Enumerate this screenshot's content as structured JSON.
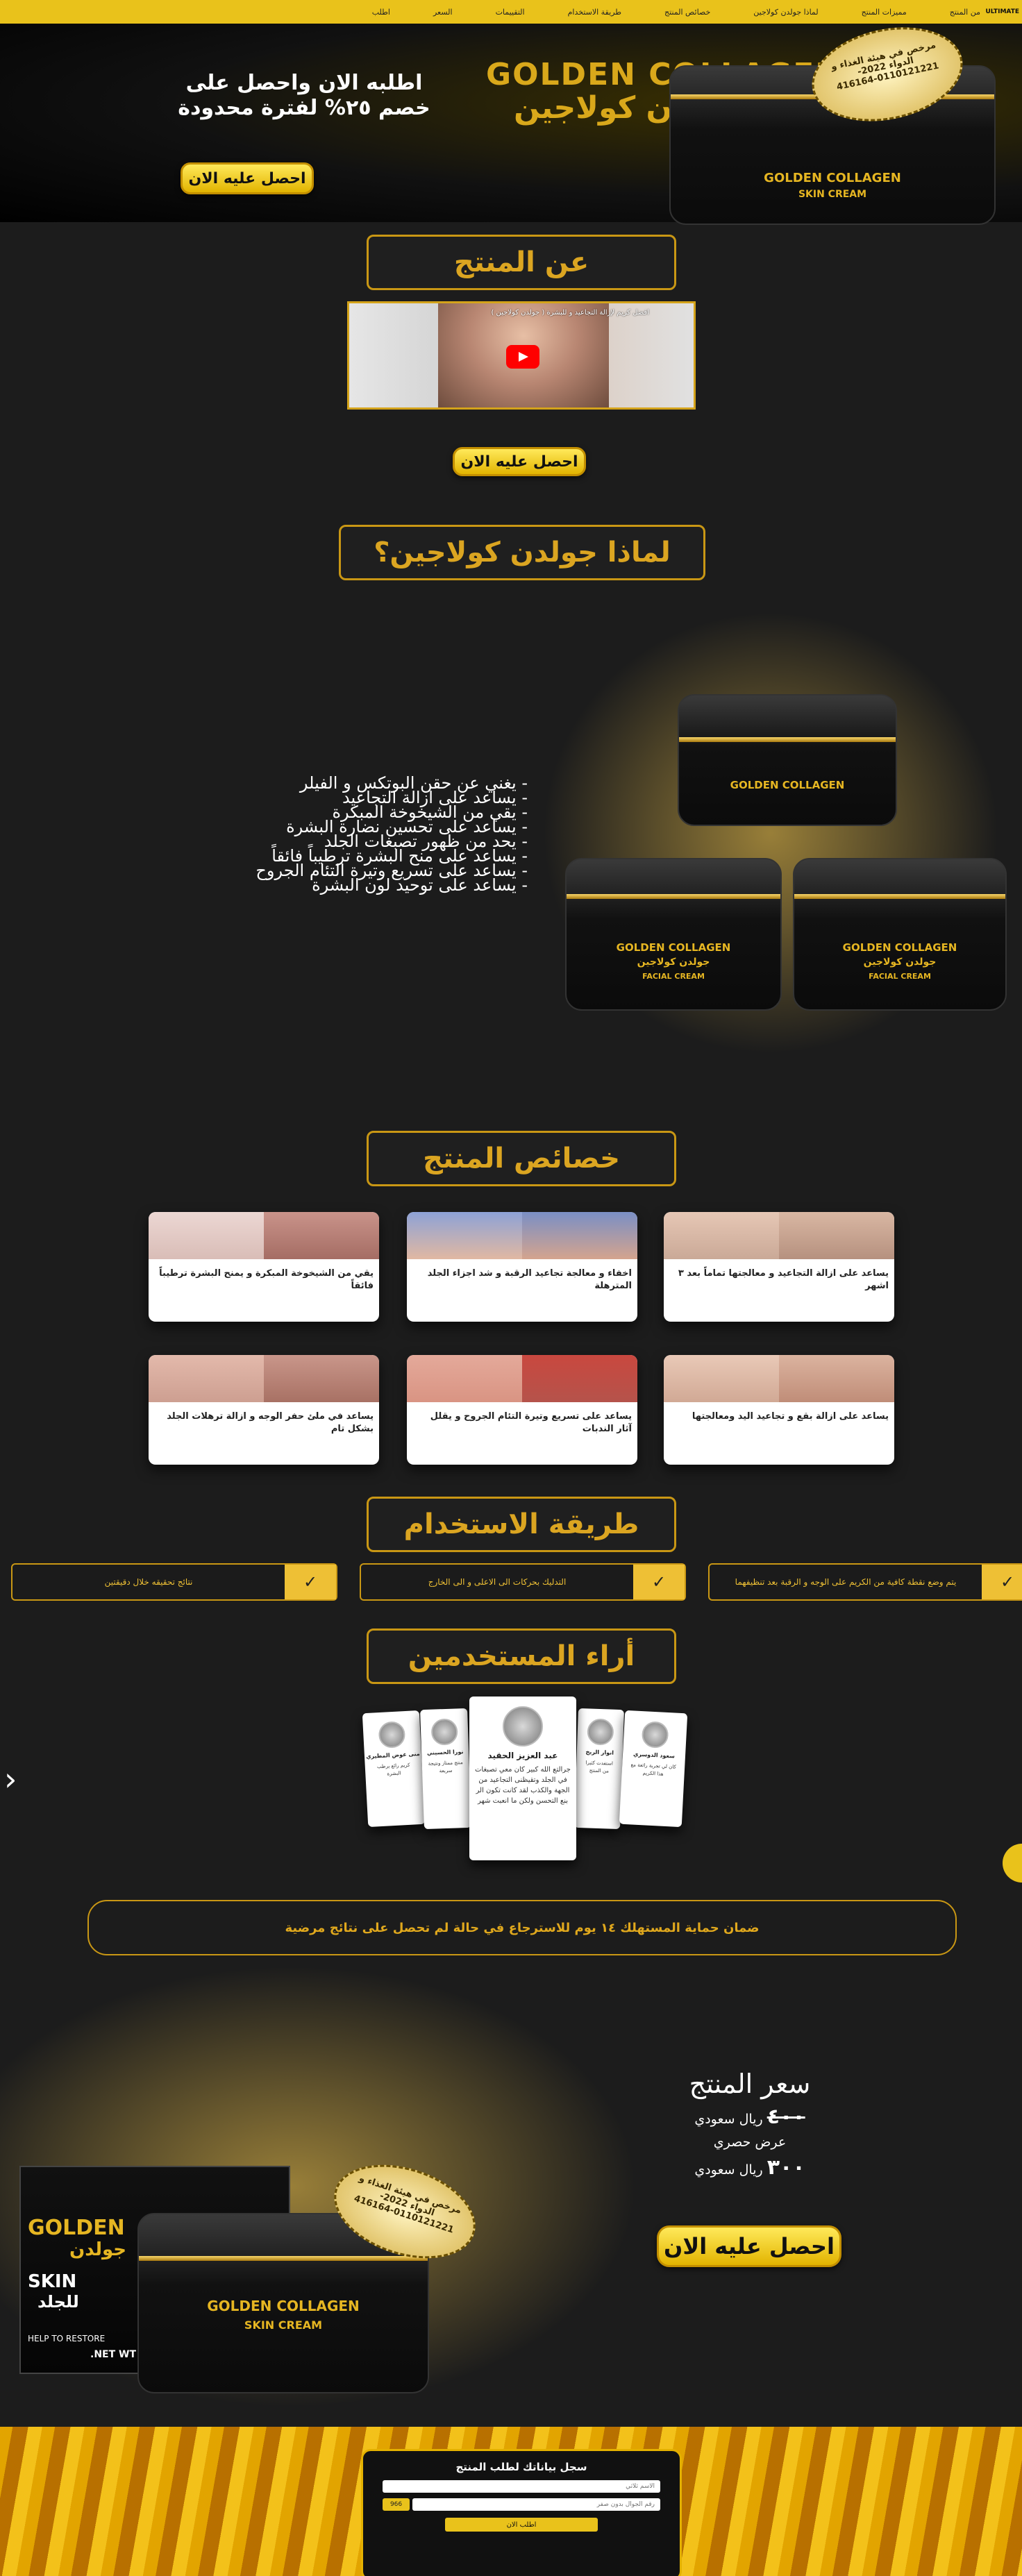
{
  "nav": {
    "items": [
      "من المنتج",
      "مميزات المنتج",
      "لماذا جولدن كولاجين",
      "خصائص المنتج",
      "طريقة الاستخدام",
      "التقييمات",
      "السعر",
      "اطلب"
    ],
    "brand": "ULTIMATE"
  },
  "hero": {
    "headline": "اطلبه الان واحصل على خصم ٢٥% لفترة محدودة",
    "cta": "احصل عليه الان",
    "product_title": "GOLDEN COLLAGEN",
    "product_title_ar": "جولدن كولاجين",
    "jar_line": "SKIN CREAM",
    "seal": "مرخص في هيئة الغذاء و الدواء 2022-0110121221-416164"
  },
  "about": {
    "title": "عن المنتج",
    "video_title": "افضل كريم لإزالة التجاعيد و للبشرة ( جولدن كولاجين )",
    "cta": "احصل عليه الان"
  },
  "why": {
    "title": "لماذا جولدن كولاجين؟",
    "benefits": [
      "- يغني عن حقن البوتكس و الفيلر",
      "- يساعد على ازالة التجاعيد",
      "- يقي من الشيخوخة المبكرة",
      "- يساعد على تحسين نضارة البشرة",
      "- يحد من ظهور تصبغات الجلد",
      "- يساعد على منح البشرة ترطيباً فائقاً",
      "- يساعد على تسريع وتيرة التئام الجروح",
      "- يساعد على توحيد لون البشرة"
    ],
    "jar_label": "GOLDEN COLLAGEN",
    "jar_label_ar": "جولدن كولاجين",
    "jar_sub": "FACIAL CREAM"
  },
  "features": {
    "title": "خصائص المنتج",
    "cards": [
      "يساعد على ازالة التجاعيد و معالجتها تماماً بعد ٣ اشهر",
      "اخفاء و معالجة تجاعيد الرقبة و شد اجزاء الجلد المترهلة",
      "يقي من الشيخوخة المبكرة و يمنح البشرة ترطيباً فائقاً",
      "يساعد على ازالة بقع و تجاعيد اليد ومعالجتها",
      "يساعد على تسريع وتيرة التئام الجروح و يقلل آثار الندبات",
      "يساعد في ملئ حفر الوجه و ازالة ترهلات الجلد بشكل تام"
    ]
  },
  "usage": {
    "title": "طريقة الاستخدام",
    "steps": [
      "يتم وضع نقطة كافية من الكريم على الوجه و الرقبة بعد تنظيفهما",
      "التدليك بحركات الى الاعلى و الى الخارج",
      "نتائج تحقيقه خلال دقيقتين"
    ],
    "check": "✓"
  },
  "reviews": {
    "title": "أراء المستخدمين",
    "cards": [
      {
        "name": "عبد العزيز الحقيد",
        "text": "جرالتع الله كبير كان معي تصبغات في الجلد وتقيظنى التجاعيد من الجهة والكذب لقد كانت تكون الر بنع التحسن ولكن ما انعبت شهر"
      },
      {
        "name": "سعود الدوسري",
        "text": "كان لي تجربة رائعة مع هذا الكريم"
      },
      {
        "name": "انوار الربخ",
        "text": "استفدت كثيرا من المنتج"
      },
      {
        "name": "نورا الحسيني",
        "text": "منتج ممتاز ونتيجة سريعة"
      },
      {
        "name": "منى عوض المطيري",
        "text": "كريم رائع يرطب البشرة"
      }
    ],
    "prev": "‹"
  },
  "guarantee": "ضمان حماية المستهلك ١٤ يوم للاسترجاع في حالة لم تحصل على نتائج مرضية",
  "price": {
    "title": "سعر المنتج",
    "old_value": "٤٠٠",
    "currency": "ريال سعودي",
    "offer": "عرض حصري",
    "new_value": "٣٠٠",
    "cta": "احصل عليه الان",
    "box_brand": "GOLDEN",
    "box_brand_ar": "جولدن",
    "box_sub": "SKIN",
    "box_sub_ar": "للجلد",
    "box_note": "HELP TO RESTORE",
    "box_weight": "NET WT."
  },
  "form": {
    "title": "سجل بياناتك لطلب المنتج",
    "name_placeholder": "الاسم ثلاثي",
    "phone_placeholder": "رقم الجوال بدون صفر",
    "country_code": "966",
    "submit": "اطلب الان"
  },
  "colors": {
    "gold": "#e9c21b",
    "accent": "#dba521",
    "bg": "#1c1c1c"
  }
}
